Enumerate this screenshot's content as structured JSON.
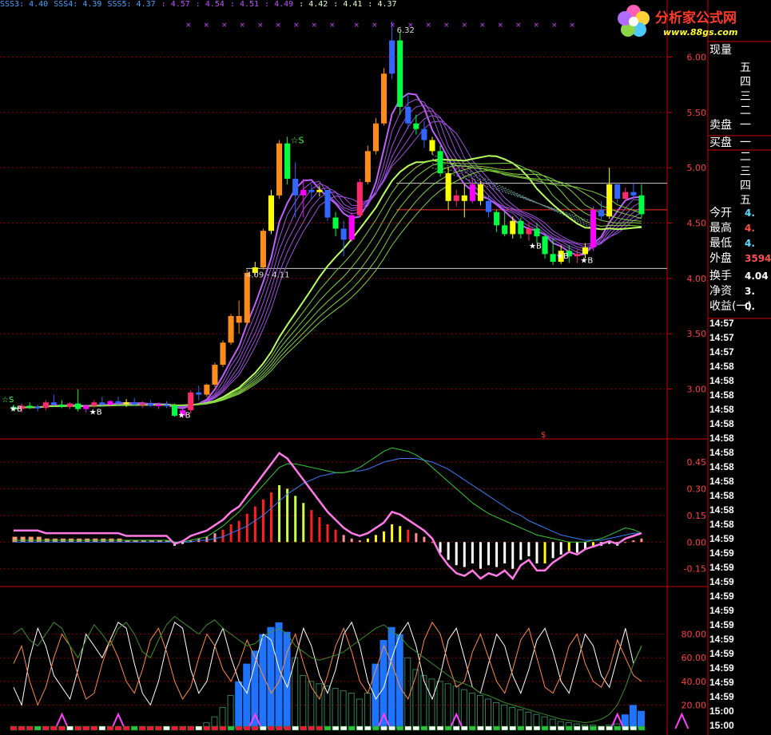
{
  "topbar": [
    {
      "text": "SSS3: 4.40",
      "color": "#4aa3ff"
    },
    {
      "text": "SSS4: 4.39",
      "color": "#4aa3ff"
    },
    {
      "text": "SSS5: 4.37",
      "color": "#4aa3ff"
    },
    {
      "text": ": 4.57",
      "color": "#c050ff"
    },
    {
      "text": ": 4.54",
      "color": "#c050ff"
    },
    {
      "text": ": 4.51",
      "color": "#c050ff"
    },
    {
      "text": ": 4.49",
      "color": "#c050ff"
    },
    {
      "text": ": 4.42",
      "color": "#e6ffc8"
    },
    {
      "text": ": 4.41",
      "color": "#e6ffc8"
    },
    {
      "text": ": 4.37",
      "color": "#e6ffc8"
    }
  ],
  "logo": {
    "title": "分析家公式网",
    "url": "www.88gs.com"
  },
  "colors": {
    "grid": "#8b0000",
    "up": "#ff2a2a",
    "down": "#00d0ff",
    "axis": "#cc0000"
  },
  "chart_data": [
    {
      "type": "candlestick",
      "ylim": [
        2.55,
        6.4
      ],
      "yticks": [
        "6.00",
        "5.50",
        "5.00",
        "4.50",
        "4.00",
        "3.50",
        "3.00"
      ],
      "annotations": [
        "6.32",
        "4.09 - 4.11",
        "☆S",
        "★B",
        "$"
      ],
      "ohlc": [
        [
          2.84,
          2.86,
          2.8,
          2.82
        ],
        [
          2.82,
          2.87,
          2.79,
          2.85
        ],
        [
          2.85,
          2.88,
          2.82,
          2.84
        ],
        [
          2.84,
          2.86,
          2.8,
          2.83
        ],
        [
          2.83,
          2.9,
          2.81,
          2.88
        ],
        [
          2.88,
          2.95,
          2.85,
          2.86
        ],
        [
          2.86,
          2.9,
          2.83,
          2.84
        ],
        [
          2.84,
          2.88,
          2.82,
          2.87
        ],
        [
          2.87,
          3.0,
          2.8,
          2.82
        ],
        [
          2.82,
          2.86,
          2.79,
          2.85
        ],
        [
          2.85,
          2.9,
          2.83,
          2.88
        ],
        [
          2.88,
          2.93,
          2.85,
          2.86
        ],
        [
          2.86,
          2.9,
          2.84,
          2.89
        ],
        [
          2.89,
          2.93,
          2.86,
          2.87
        ],
        [
          2.87,
          2.91,
          2.84,
          2.88
        ],
        [
          2.88,
          2.92,
          2.85,
          2.86
        ],
        [
          2.86,
          2.89,
          2.83,
          2.87
        ],
        [
          2.87,
          2.9,
          2.84,
          2.85
        ],
        [
          2.85,
          2.88,
          2.82,
          2.86
        ],
        [
          2.86,
          2.89,
          2.83,
          2.85
        ],
        [
          2.85,
          2.87,
          2.75,
          2.76
        ],
        [
          2.76,
          2.82,
          2.74,
          2.81
        ],
        [
          2.81,
          2.99,
          2.78,
          2.97
        ],
        [
          2.97,
          3.03,
          2.9,
          2.95
        ],
        [
          2.95,
          3.05,
          2.93,
          3.04
        ],
        [
          3.04,
          3.24,
          3.02,
          3.22
        ],
        [
          3.22,
          3.44,
          3.2,
          3.42
        ],
        [
          3.42,
          3.68,
          3.4,
          3.66
        ],
        [
          3.66,
          3.8,
          3.5,
          3.6
        ],
        [
          3.6,
          4.08,
          3.58,
          4.05
        ],
        [
          4.05,
          4.15,
          4.03,
          4.1
        ],
        [
          4.1,
          4.45,
          4.08,
          4.43
        ],
        [
          4.43,
          4.8,
          4.4,
          4.75
        ],
        [
          4.75,
          5.25,
          4.72,
          5.22
        ],
        [
          5.22,
          5.28,
          4.85,
          4.9
        ],
        [
          4.9,
          5.05,
          4.55,
          4.75
        ],
        [
          4.75,
          4.9,
          4.55,
          4.8
        ],
        [
          4.8,
          4.85,
          4.72,
          4.78
        ],
        [
          4.78,
          4.84,
          4.74,
          4.8
        ],
        [
          4.8,
          4.72,
          4.52,
          4.55
        ],
        [
          4.55,
          4.6,
          4.38,
          4.45
        ],
        [
          4.45,
          4.52,
          4.2,
          4.35
        ],
        [
          4.35,
          4.6,
          4.33,
          4.57
        ],
        [
          4.57,
          4.9,
          4.55,
          4.87
        ],
        [
          4.87,
          5.2,
          4.85,
          5.15
        ],
        [
          5.15,
          5.45,
          5.12,
          5.4
        ],
        [
          5.4,
          5.9,
          5.38,
          5.85
        ],
        [
          5.85,
          6.32,
          5.8,
          6.15
        ],
        [
          6.15,
          6.22,
          5.48,
          5.55
        ],
        [
          5.55,
          5.65,
          5.35,
          5.4
        ],
        [
          5.4,
          5.48,
          5.3,
          5.35
        ],
        [
          5.35,
          5.42,
          5.18,
          5.25
        ],
        [
          5.25,
          5.28,
          5.12,
          5.15
        ],
        [
          5.15,
          5.2,
          4.92,
          4.95
        ],
        [
          4.95,
          5.0,
          4.62,
          4.7
        ],
        [
          4.7,
          4.8,
          4.65,
          4.75
        ],
        [
          4.75,
          4.85,
          4.55,
          4.7
        ],
        [
          4.7,
          4.9,
          4.68,
          4.85
        ],
        [
          4.85,
          4.88,
          4.66,
          4.7
        ],
        [
          4.7,
          4.75,
          4.55,
          4.6
        ],
        [
          4.6,
          4.62,
          4.42,
          4.48
        ],
        [
          4.48,
          4.6,
          4.38,
          4.4
        ],
        [
          4.4,
          4.56,
          4.36,
          4.52
        ],
        [
          4.52,
          4.55,
          4.36,
          4.4
        ],
        [
          4.4,
          4.5,
          4.34,
          4.45
        ],
        [
          4.45,
          4.5,
          4.32,
          4.38
        ],
        [
          4.38,
          4.4,
          4.18,
          4.22
        ],
        [
          4.22,
          4.36,
          4.12,
          4.15
        ],
        [
          4.15,
          4.3,
          4.13,
          4.25
        ],
        [
          4.25,
          4.3,
          4.14,
          4.2
        ],
        [
          4.2,
          4.26,
          4.14,
          4.22
        ],
        [
          4.22,
          4.32,
          4.18,
          4.28
        ],
        [
          4.28,
          4.65,
          4.25,
          4.62
        ],
        [
          4.62,
          4.7,
          4.52,
          4.56
        ],
        [
          4.56,
          5.0,
          4.54,
          4.85
        ],
        [
          4.85,
          4.82,
          4.68,
          4.72
        ],
        [
          4.72,
          4.82,
          4.7,
          4.78
        ],
        [
          4.78,
          4.86,
          4.72,
          4.75
        ],
        [
          4.75,
          4.85,
          4.55,
          4.58
        ]
      ]
    },
    {
      "type": "macd",
      "ylim": [
        -0.25,
        0.58
      ],
      "yticks": [
        "0.45",
        "0.30",
        "0.15",
        "0.00",
        "-0.15"
      ],
      "hist": [
        0.03,
        0.03,
        0.03,
        0.03,
        0.02,
        0.02,
        0.02,
        0.02,
        0.02,
        0.02,
        0.02,
        0.02,
        0.02,
        0.02,
        0.01,
        0.01,
        0.01,
        0.01,
        0.01,
        0.01,
        -0.02,
        -0.01,
        0.01,
        0.02,
        0.03,
        0.05,
        0.07,
        0.1,
        0.12,
        0.16,
        0.2,
        0.24,
        0.28,
        0.32,
        0.3,
        0.26,
        0.22,
        0.18,
        0.14,
        0.1,
        0.07,
        0.04,
        0.02,
        0.01,
        0.02,
        0.04,
        0.06,
        0.1,
        0.09,
        0.07,
        0.05,
        0.03,
        0.0,
        -0.06,
        -0.1,
        -0.13,
        -0.14,
        -0.12,
        -0.15,
        -0.13,
        -0.14,
        -0.12,
        -0.15,
        -0.1,
        -0.08,
        -0.12,
        -0.12,
        -0.09,
        -0.07,
        -0.05,
        -0.06,
        -0.04,
        -0.03,
        -0.02,
        -0.01,
        -0.02,
        0.0,
        0.01,
        0.02
      ],
      "dif": [
        0.01,
        0.01,
        0.01,
        0.01,
        0.01,
        0.01,
        0.01,
        0.01,
        0.01,
        0.01,
        0.01,
        0.01,
        0.01,
        0.01,
        0.01,
        0.01,
        0.01,
        0.01,
        0.01,
        0.01,
        0.0,
        0.0,
        0.01,
        0.02,
        0.03,
        0.06,
        0.09,
        0.13,
        0.17,
        0.22,
        0.27,
        0.32,
        0.37,
        0.42,
        0.44,
        0.44,
        0.43,
        0.42,
        0.41,
        0.4,
        0.39,
        0.39,
        0.4,
        0.42,
        0.45,
        0.48,
        0.51,
        0.53,
        0.52,
        0.51,
        0.49,
        0.46,
        0.42,
        0.38,
        0.34,
        0.3,
        0.26,
        0.22,
        0.19,
        0.16,
        0.14,
        0.12,
        0.1,
        0.08,
        0.06,
        0.04,
        0.03,
        0.02,
        0.01,
        0.0,
        0.0,
        0.0,
        0.01,
        0.02,
        0.04,
        0.06,
        0.08,
        0.07,
        0.05
      ],
      "dea": [
        0.0,
        0.0,
        0.0,
        0.0,
        0.0,
        0.0,
        0.0,
        0.0,
        0.0,
        0.0,
        0.0,
        0.0,
        0.0,
        0.0,
        0.0,
        0.0,
        0.0,
        0.0,
        0.0,
        0.0,
        0.0,
        0.0,
        0.0,
        0.01,
        0.01,
        0.02,
        0.03,
        0.05,
        0.07,
        0.09,
        0.12,
        0.15,
        0.19,
        0.23,
        0.27,
        0.3,
        0.33,
        0.35,
        0.37,
        0.38,
        0.39,
        0.39,
        0.4,
        0.4,
        0.41,
        0.43,
        0.45,
        0.46,
        0.47,
        0.47,
        0.47,
        0.46,
        0.45,
        0.43,
        0.41,
        0.38,
        0.35,
        0.32,
        0.29,
        0.26,
        0.23,
        0.2,
        0.17,
        0.15,
        0.12,
        0.1,
        0.08,
        0.06,
        0.04,
        0.03,
        0.02,
        0.01,
        0.01,
        0.01,
        0.02,
        0.03,
        0.04,
        0.05,
        0.05
      ]
    },
    {
      "type": "oscillator",
      "ylim": [
        0,
        100
      ],
      "yticks": [
        "80.00",
        "60.00",
        "40.00",
        "20.00"
      ],
      "bars": [
        0,
        0,
        0,
        0,
        0,
        0,
        0,
        0,
        0,
        0,
        0,
        0,
        0,
        0,
        0,
        0,
        0,
        0,
        0,
        0,
        0,
        0,
        0,
        0,
        5,
        10,
        18,
        28,
        40,
        55,
        66,
        80,
        86,
        90,
        82,
        60,
        45,
        40,
        38,
        36,
        34,
        32,
        30,
        25,
        30,
        55,
        75,
        86,
        80,
        60,
        50,
        45,
        42,
        40,
        38,
        36,
        33,
        30,
        28,
        25,
        22,
        20,
        18,
        16,
        14,
        12,
        10,
        8,
        6,
        5,
        4,
        3,
        3,
        2,
        3,
        4,
        12,
        20,
        15
      ],
      "lines": [
        [
          35,
          20,
          60,
          85,
          70,
          45,
          35,
          25,
          50,
          80,
          70,
          60,
          75,
          90,
          85,
          55,
          30,
          20,
          40,
          70,
          90,
          85,
          50,
          30,
          40,
          70,
          85,
          60,
          40,
          30,
          55,
          80,
          75,
          50,
          35,
          60,
          85,
          70,
          45,
          30,
          50,
          80,
          90,
          70,
          40,
          25,
          35,
          60,
          80,
          90,
          70,
          40,
          25,
          45,
          75,
          85,
          60,
          35,
          30,
          55,
          80,
          70,
          45,
          30,
          50,
          75,
          85,
          65,
          40,
          30,
          55,
          80,
          70,
          45,
          35,
          60,
          85,
          55,
          70
        ],
        [
          55,
          70,
          40,
          20,
          35,
          60,
          80,
          70,
          45,
          25,
          30,
          55,
          75,
          60,
          40,
          30,
          50,
          75,
          85,
          65,
          40,
          25,
          35,
          60,
          80,
          70,
          50,
          40,
          55,
          75,
          60,
          45,
          30,
          40,
          65,
          80,
          55,
          35,
          25,
          45,
          70,
          85,
          65,
          40,
          30,
          50,
          70,
          55,
          35,
          25,
          45,
          75,
          90,
          80,
          55,
          35,
          40,
          65,
          80,
          60,
          40,
          30,
          50,
          75,
          85,
          60,
          35,
          30,
          45,
          70,
          80,
          55,
          40,
          35,
          50,
          75,
          60,
          45,
          40
        ],
        [
          80,
          85,
          75,
          70,
          80,
          90,
          85,
          70,
          60,
          75,
          88,
          80,
          70,
          85,
          90,
          80,
          65,
          60,
          75,
          88,
          95,
          90,
          85,
          80,
          88,
          92,
          85,
          80,
          75,
          70,
          72,
          78,
          82,
          85,
          80,
          70,
          65,
          60,
          58,
          60,
          62,
          65,
          70,
          75,
          80,
          85,
          88,
          82,
          78,
          70,
          65,
          60,
          55,
          50,
          45,
          40,
          38,
          35,
          30,
          28,
          25,
          22,
          20,
          18,
          16,
          14,
          12,
          10,
          8,
          7,
          6,
          5,
          6,
          8,
          12,
          20,
          35,
          55,
          70
        ]
      ]
    }
  ],
  "quote_panel": {
    "title": "现量",
    "sell_levels": [
      "五",
      "四",
      "三",
      "二",
      "一"
    ],
    "sell_label": "卖盘",
    "buy_label": "买盘",
    "buy_levels": [
      "一",
      "二",
      "三",
      "四",
      "五"
    ],
    "rows": [
      {
        "label": "今开",
        "value": "4.",
        "color": "#5fe0ff"
      },
      {
        "label": "最高",
        "value": "4.",
        "color": "#ff5050"
      },
      {
        "label": "最低",
        "value": "4.",
        "color": "#5fe0ff"
      },
      {
        "label": "外盘",
        "value": "3594",
        "color": "#ff5050"
      },
      {
        "label": "换手",
        "value": "4.04",
        "color": "#ffffff"
      },
      {
        "label": "净资",
        "value": "3.",
        "color": "#ffffff"
      },
      {
        "label": "收益(一)",
        "value": "0.",
        "color": "#ffffff"
      }
    ],
    "times": [
      "14:57",
      "14:57",
      "14:57",
      "14:58",
      "14:58",
      "14:58",
      "14:58",
      "14:58",
      "14:58",
      "14:58",
      "14:58",
      "14:58",
      "14:58",
      "14:58",
      "14:58",
      "14:59",
      "14:59",
      "14:59",
      "14:59",
      "14:59",
      "14:59",
      "14:59",
      "14:59",
      "14:59",
      "14:59",
      "14:59",
      "14:59",
      "15:00",
      "15:00"
    ]
  }
}
